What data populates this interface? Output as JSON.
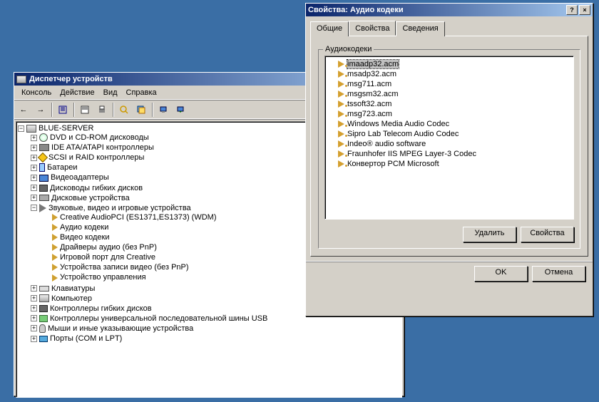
{
  "devmgr": {
    "title": "Диспетчер устройств",
    "menu": [
      "Консоль",
      "Действие",
      "Вид",
      "Справка"
    ],
    "root": "BLUE-SERVER",
    "nodes": [
      {
        "label": "DVD и CD-ROM дисководы",
        "icon": "i-disc"
      },
      {
        "label": "IDE ATA/ATAPI контроллеры",
        "icon": "i-ctrl"
      },
      {
        "label": "SCSI и RAID контроллеры",
        "icon": "i-diamond"
      },
      {
        "label": "Батареи",
        "icon": "i-batt"
      },
      {
        "label": "Видеоадаптеры",
        "icon": "i-mon"
      },
      {
        "label": "Дисководы гибких дисков",
        "icon": "i-fd"
      },
      {
        "label": "Дисковые устройства",
        "icon": "i-hdd"
      }
    ],
    "sound": {
      "label": "Звуковые, видео и игровые устройства",
      "children": [
        "Creative AudioPCI (ES1371,ES1373) (WDM)",
        "Аудио кодеки",
        "Видео кодеки",
        "Драйверы аудио (без PnP)",
        "Игровой порт для Creative",
        "Устройства записи видео (без PnP)",
        "Устройство управления"
      ]
    },
    "nodes2": [
      {
        "label": "Клавиатуры",
        "icon": "i-kb"
      },
      {
        "label": "Компьютер",
        "icon": "i-pc"
      },
      {
        "label": "Контроллеры гибких дисков",
        "icon": "i-fd"
      },
      {
        "label": "Контроллеры универсальной последовательной шины USB",
        "icon": "i-usb"
      },
      {
        "label": "Мыши и иные указывающие устройства",
        "icon": "i-mouse"
      },
      {
        "label": "Порты (COM и LPT)",
        "icon": "i-port"
      }
    ]
  },
  "props": {
    "title": "Свойства: Аудио кодеки",
    "tabs": [
      "Общие",
      "Свойства",
      "Сведения"
    ],
    "group": "Аудиокодеки",
    "codecs": [
      "imaadp32.acm",
      "msadp32.acm",
      "msg711.acm",
      "msgsm32.acm",
      "tssoft32.acm",
      "msg723.acm",
      "Windows Media Audio Codec",
      "Sipro Lab Telecom Audio Codec",
      "Indeo® audio software",
      "Fraunhofer IIS MPEG Layer-3 Codec",
      "Конвертор PCM Microsoft"
    ],
    "btn_delete": "Удалить",
    "btn_props": "Свойства",
    "btn_ok": "OK",
    "btn_cancel": "Отмена"
  }
}
